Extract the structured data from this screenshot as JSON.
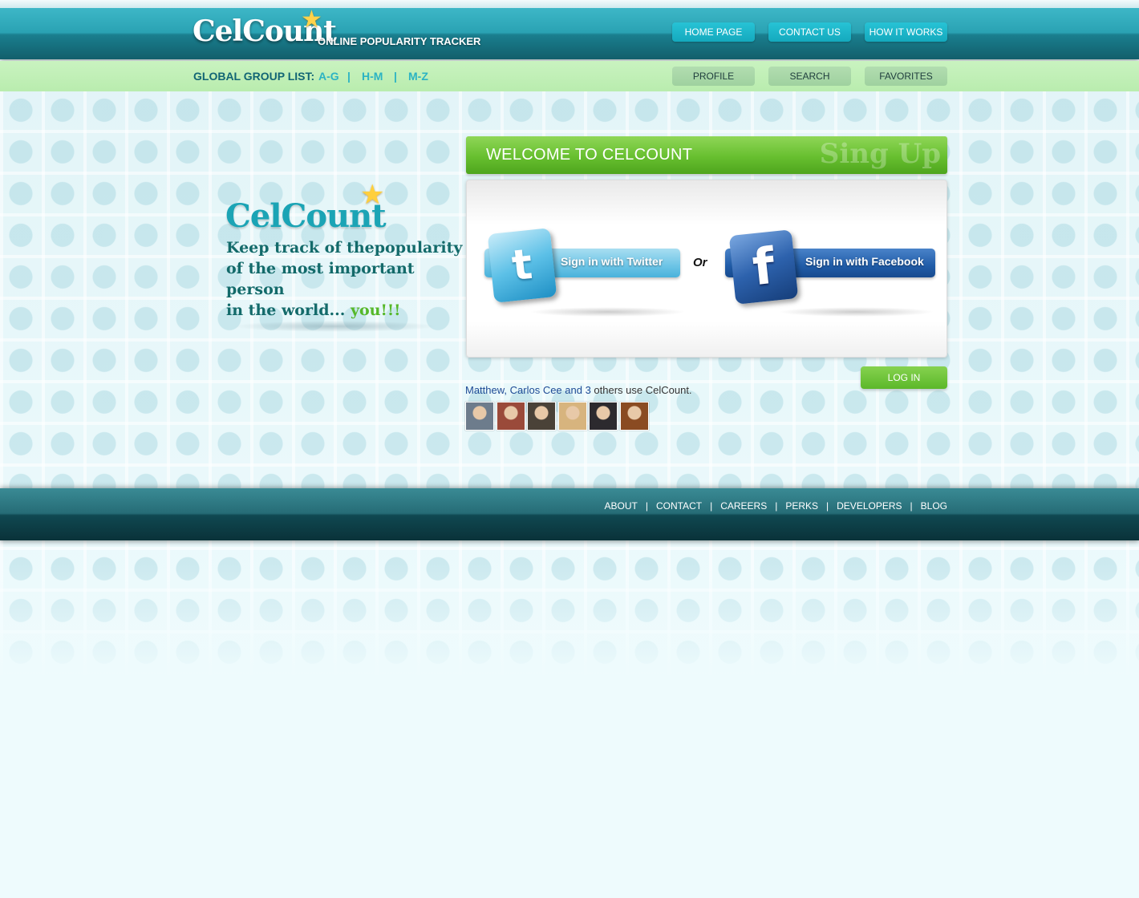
{
  "header": {
    "logo": "CelCount",
    "tagline": "ONLINE POPULARITY TRACKER",
    "nav": [
      "HOME PAGE",
      "CONTACT US",
      "HOW IT WORKS"
    ]
  },
  "subbar": {
    "label": "GLOBAL GROUP LIST:",
    "groups": [
      "A-G",
      "H-M",
      "M-Z"
    ],
    "separator": "|",
    "nav": [
      "PROFILE",
      "SEARCH",
      "FAVORITES"
    ]
  },
  "promo": {
    "logo": "CelCount",
    "line1": "Keep track of thepopularity",
    "line2": "of the most important person",
    "line3": "in the world...",
    "highlight": "you!!!"
  },
  "welcome": {
    "title": "WELCOME TO CELCOUNT",
    "signup": "Sing Up"
  },
  "signin": {
    "twitter_label": "Sign in with Twitter",
    "or": "Or",
    "facebook_label": "Sign in with Facebook"
  },
  "login": {
    "label": "LOG IN"
  },
  "friends": {
    "names": "Matthew, Carlos Cee and 3",
    "rest": " others use CelCount.",
    "avatars": [
      {
        "name": "avatar-1",
        "color": "#6d7c8c"
      },
      {
        "name": "avatar-2",
        "color": "#9a4a3a"
      },
      {
        "name": "avatar-3",
        "color": "#4a4238"
      },
      {
        "name": "avatar-4",
        "color": "#d7b47e"
      },
      {
        "name": "avatar-5",
        "color": "#2c2a2e"
      },
      {
        "name": "avatar-6",
        "color": "#8a4b22"
      }
    ]
  },
  "footer": {
    "links": [
      "ABOUT",
      "CONTACT",
      "CAREERS",
      "PERKS",
      "DEVELOPERS",
      "BLOG"
    ],
    "separator": "|"
  },
  "colors": {
    "header_teal": "#1a7f8f",
    "subbar_green": "#c9f3c0",
    "welcome_green": "#67bf2f",
    "twitter_blue": "#49b2db",
    "facebook_blue": "#205ca8",
    "page_background": "#eefbfd"
  },
  "icons": [
    "star-icon",
    "twitter-icon",
    "facebook-icon"
  ]
}
